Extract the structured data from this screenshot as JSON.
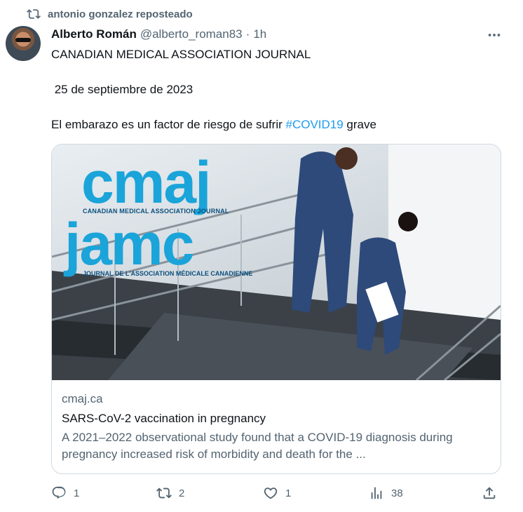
{
  "repost": {
    "icon": "repost-icon",
    "text": "antonio gonzalez reposteado"
  },
  "tweet": {
    "author_name": "Alberto Román",
    "handle": "@alberto_roman83",
    "separator": "·",
    "time": "1h",
    "more_icon": "more-icon",
    "line1": "CANADIAN MEDICAL ASSOCIATION JOURNAL",
    "line2": " 25 de septiembre de 2023",
    "line3_prefix": "El embarazo es un factor de riesgo de sufrir ",
    "line3_hashtag": "#COVID19",
    "line3_suffix": " grave"
  },
  "card": {
    "logo_top": "cmaj",
    "logo_top_sub": "CANADIAN MEDICAL ASSOCIATION JOURNAL",
    "logo_bottom": "jamc",
    "logo_bottom_sub": "JOURNAL DE L'ASSOCIATION MÉDICALE CANADIENNE",
    "domain": "cmaj.ca",
    "title": "SARS-CoV-2 vaccination in pregnancy",
    "description": "A 2021–2022 observational study found that a COVID-19 diagnosis during pregnancy increased risk of morbidity and death for the ..."
  },
  "actions": {
    "reply_count": "1",
    "repost_count": "2",
    "like_count": "1",
    "views_count": "38"
  },
  "colors": {
    "accent": "#1d9bf0",
    "muted": "#536471",
    "text": "#0f1419",
    "border": "#cfd9de",
    "logo_blue": "#1aa4d9"
  }
}
